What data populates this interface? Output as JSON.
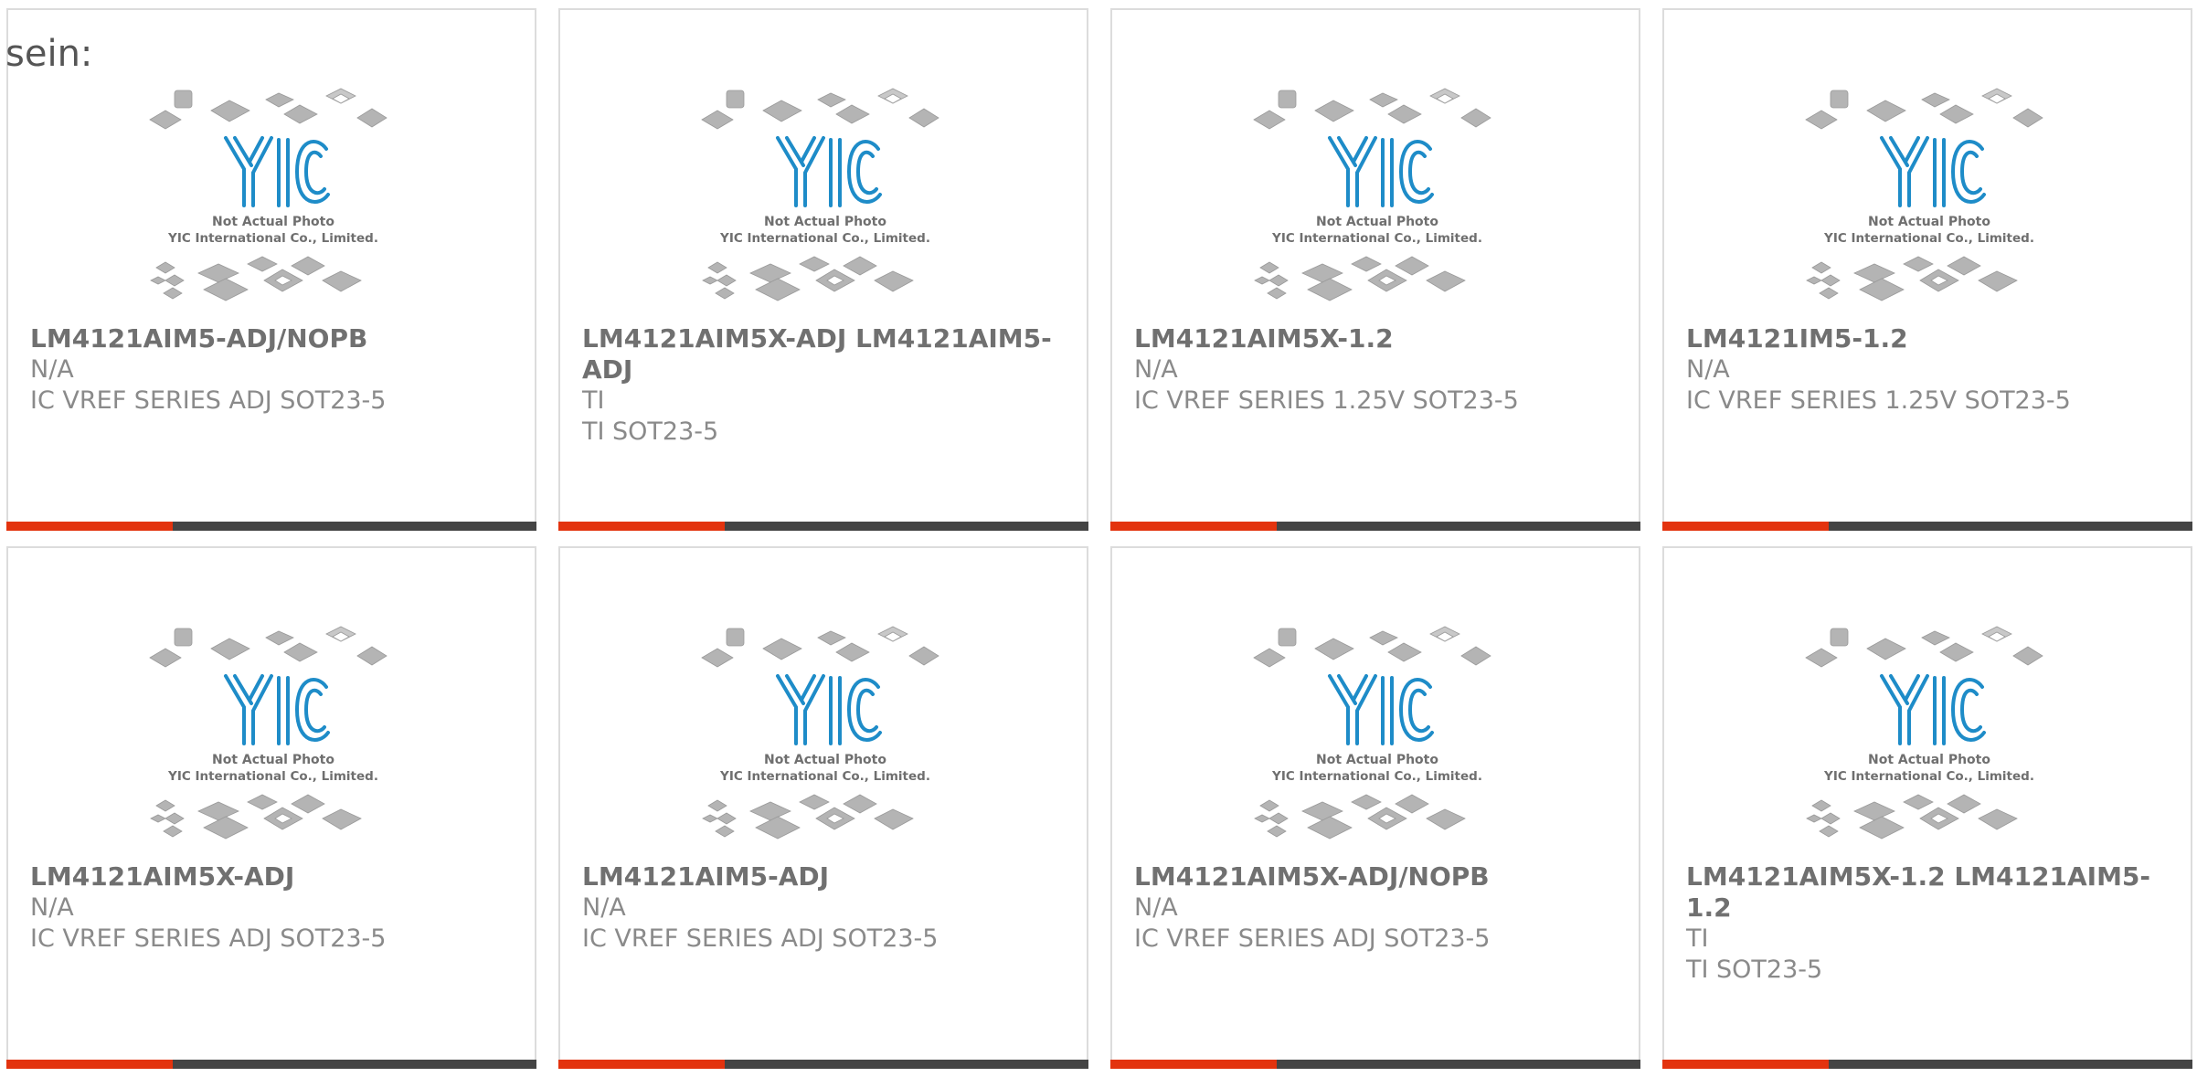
{
  "page": {
    "label": "sein:"
  },
  "placeholder_image": {
    "brand": "YIC",
    "caption_line1": "Not Actual Photo",
    "caption_line2": "YIC International Co., Limited."
  },
  "colors": {
    "accent": "#e3330e",
    "bar": "#444444",
    "logo_blue": "#1e8cc8",
    "chip_gray": "#b4b4b4",
    "border": "#dcdcdc"
  },
  "products": [
    {
      "name": "LM4121AIM5-ADJ/NOPB",
      "manufacturer": "N/A",
      "description": "IC VREF SERIES ADJ SOT23-5"
    },
    {
      "name": "LM4121AIM5X-ADJ LM4121AIM5-ADJ",
      "manufacturer": "TI",
      "description": "TI SOT23-5"
    },
    {
      "name": "LM4121AIM5X-1.2",
      "manufacturer": "N/A",
      "description": "IC VREF SERIES 1.25V SOT23-5"
    },
    {
      "name": "LM4121IM5-1.2",
      "manufacturer": "N/A",
      "description": "IC VREF SERIES 1.25V SOT23-5"
    },
    {
      "name": "LM4121AIM5X-ADJ",
      "manufacturer": "N/A",
      "description": "IC VREF SERIES ADJ SOT23-5"
    },
    {
      "name": "LM4121AIM5-ADJ",
      "manufacturer": "N/A",
      "description": "IC VREF SERIES ADJ SOT23-5"
    },
    {
      "name": "LM4121AIM5X-ADJ/NOPB",
      "manufacturer": "N/A",
      "description": "IC VREF SERIES ADJ SOT23-5"
    },
    {
      "name": "LM4121AIM5X-1.2 LM4121AIM5-1.2",
      "manufacturer": "TI",
      "description": "TI SOT23-5"
    }
  ]
}
